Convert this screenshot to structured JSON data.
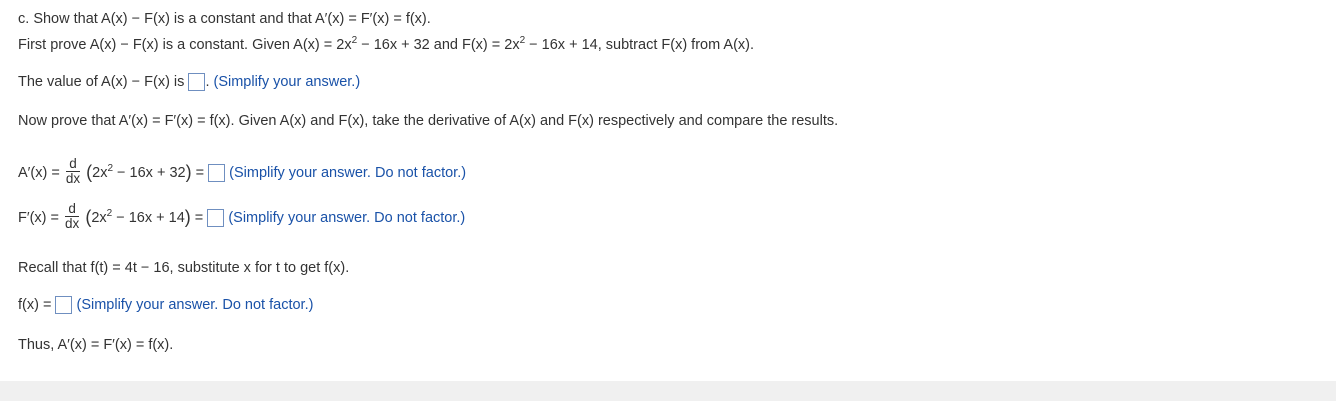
{
  "part_c": {
    "label": "c.",
    "title": "Show that A(x) − F(x) is a constant and that A′(x) = F′(x) = f(x).",
    "intro": "First prove A(x) − F(x) is a constant. Given A(x) = 2x",
    "intro_mid": " − 16x + 32 and F(x) = 2x",
    "intro_end": " − 16x + 14, subtract F(x) from A(x).",
    "sup2": "2"
  },
  "q1": {
    "prefix": "The value of A(x) − F(x) is",
    "period": ".",
    "hint": "(Simplify your answer.)"
  },
  "derivative_intro": "Now prove that A′(x) = F′(x) = f(x). Given A(x) and F(x), take the derivative of A(x) and F(x) respectively and compare the results.",
  "q2": {
    "lhs": "A′(x) =",
    "d": "d",
    "dx": "dx",
    "expr_a": "2x",
    "expr_b": " − 16x + 32",
    "equals": "=",
    "hint": "(Simplify your answer. Do not factor.)"
  },
  "q3": {
    "lhs": "F′(x) =",
    "d": "d",
    "dx": "dx",
    "expr_a": "2x",
    "expr_b": " − 16x + 14",
    "equals": "=",
    "hint": "(Simplify your answer. Do not factor.)"
  },
  "recall": "Recall that f(t) = 4t − 16, substitute x for t to get f(x).",
  "q4": {
    "lhs": "f(x) =",
    "hint": "(Simplify your answer. Do not factor.)"
  },
  "conclusion": "Thus, A′(x) = F′(x) = f(x)."
}
